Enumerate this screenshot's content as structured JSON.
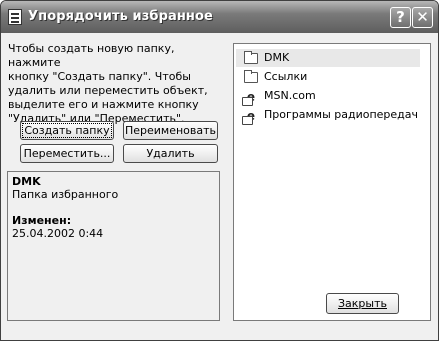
{
  "window": {
    "title": "Упорядочить избранное",
    "help_icon": "?",
    "close_icon": "✕"
  },
  "instructions": {
    "line1": "Чтобы создать новую папку, нажмите",
    "line2": "кнопку \"Создать папку\". Чтобы",
    "line3": "удалить или переместить объект,",
    "line4": "выделите его и нажмите кнопку",
    "line5": "\"Удалить\" или \"Переместить\"."
  },
  "buttons": {
    "create_folder": "Создать папку",
    "rename": "Переименовать",
    "move": "Переместить...",
    "delete": "Удалить",
    "close": "Закрыть"
  },
  "details": {
    "name": "DMK",
    "type": "Папка избранного",
    "modified_label": "Изменен:",
    "modified_value": "25.04.2002 0:44"
  },
  "favorites": [
    {
      "label": "DMK",
      "icon": "folder-icon",
      "selected": true
    },
    {
      "label": "Ссылки",
      "icon": "folder-icon",
      "selected": false
    },
    {
      "label": "MSN.com",
      "icon": "ie-link-icon",
      "selected": false
    },
    {
      "label": "Программы радиопередач",
      "icon": "ie-link-icon",
      "selected": false
    }
  ]
}
